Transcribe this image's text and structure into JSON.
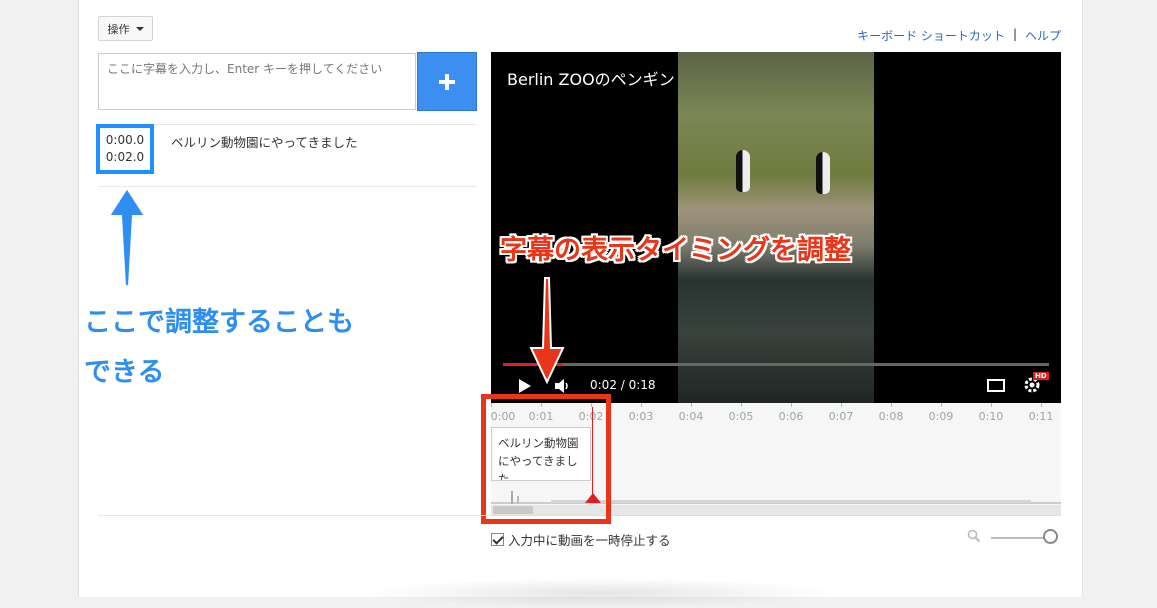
{
  "toolbar": {
    "actions_label": "操作"
  },
  "top_links": {
    "shortcuts": "キーボード ショートカット",
    "separator": "|",
    "help": "ヘルプ"
  },
  "caption_input": {
    "placeholder": "ここに字幕を入力し、Enter キーを押してください"
  },
  "cues": [
    {
      "start": "0:00.0",
      "end": "0:02.0",
      "text": "ベルリン動物園にやってきました"
    }
  ],
  "video": {
    "title": "Berlin ZOOのペンギン",
    "current_time": "0:02",
    "duration": "0:18",
    "time_readout": "0:02 / 0:18",
    "hd_badge": "HD",
    "progress_fraction": 0.11
  },
  "timeline": {
    "ticks": [
      "0:00",
      "0:01",
      "0:02",
      "0:03",
      "0:04",
      "0:05",
      "0:06",
      "0:07",
      "0:08",
      "0:09",
      "0:10",
      "0:11"
    ],
    "cue_block_text": "ベルリン動物園にやってきました"
  },
  "annotations": {
    "blue_label_line1": "ここで調整することも",
    "blue_label_line2": "できる",
    "red_label": "字幕の表示タイミングを調整"
  },
  "pause_option": {
    "label": "入力中に動画を一時停止する",
    "checked": true
  },
  "colors": {
    "accent_blue": "#3c8ff0",
    "annotation_blue": "#2f8ff0",
    "annotation_red": "#e8361b",
    "playhead": "#e02020"
  },
  "icons": [
    "chevron-down-icon",
    "plus-icon",
    "play-icon",
    "volume-icon",
    "captions-icon",
    "gear-icon",
    "search-icon",
    "arrow-up-icon",
    "arrow-down-icon"
  ]
}
